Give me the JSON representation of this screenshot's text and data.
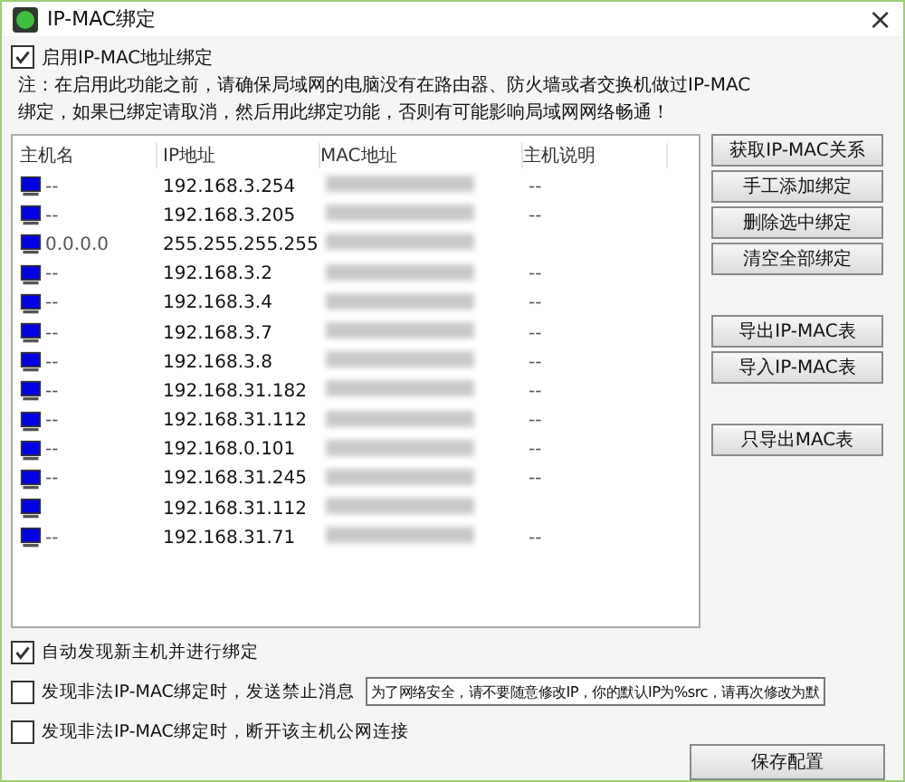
{
  "window": {
    "title": "IP-MAC绑定",
    "close": "×"
  },
  "enable": {
    "label": "启用IP-MAC地址绑定",
    "checked": true
  },
  "note": "注：在启用此功能之前，请确保局域网的电脑没有在路由器、防火墙或者交换机做过IP-MAC绑定，如果已绑定请取消，然后用此绑定功能，否则有可能影响局域网网络畅通！",
  "table": {
    "columns": [
      "主机名",
      "IP地址",
      "MAC地址",
      "主机说明"
    ],
    "rows": [
      {
        "host": "--",
        "ip": "192.168.3.254",
        "note": "--"
      },
      {
        "host": "--",
        "ip": "192.168.3.205",
        "note": "--"
      },
      {
        "host": "0.0.0.0",
        "ip": "255.255.255.255"
      },
      {
        "host": "--",
        "ip": "192.168.3.2",
        "note": "--"
      },
      {
        "host": "--",
        "ip": "192.168.3.4",
        "note": "--"
      },
      {
        "host": "--",
        "ip": "192.168.3.7",
        "note": "--"
      },
      {
        "host": "--",
        "ip": "192.168.3.8",
        "note": "--"
      },
      {
        "host": "--",
        "ip": "192.168.31.182",
        "note": "--"
      },
      {
        "host": "--",
        "ip": "192.168.31.112",
        "note": "--"
      },
      {
        "host": "--",
        "ip": "192.168.0.101",
        "note": "--"
      },
      {
        "host": "--",
        "ip": "192.168.31.245",
        "note": "--"
      },
      {
        "ip": "192.168.31.112"
      },
      {
        "host": "--",
        "ip": "192.168.31.71",
        "note": "--"
      }
    ]
  },
  "button_groups": [
    [
      "获取IP-MAC关系",
      "手工添加绑定",
      "删除选中绑定",
      "清空全部绑定"
    ],
    [
      "导出IP-MAC表",
      "导入IP-MAC表"
    ],
    [
      "只导出MAC表"
    ]
  ],
  "options": [
    {
      "label": "自动发现新主机并进行绑定",
      "checked": true
    },
    {
      "label": "发现非法IP-MAC绑定时，发送禁止消息",
      "checked": false,
      "value": "为了网络安全，请不要随意修改IP，你的默认IP为%src，请再次修改为默"
    },
    {
      "label": "发现非法IP-MAC绑定时，断开该主机公网连接",
      "checked": false
    }
  ],
  "save": "保存配置"
}
